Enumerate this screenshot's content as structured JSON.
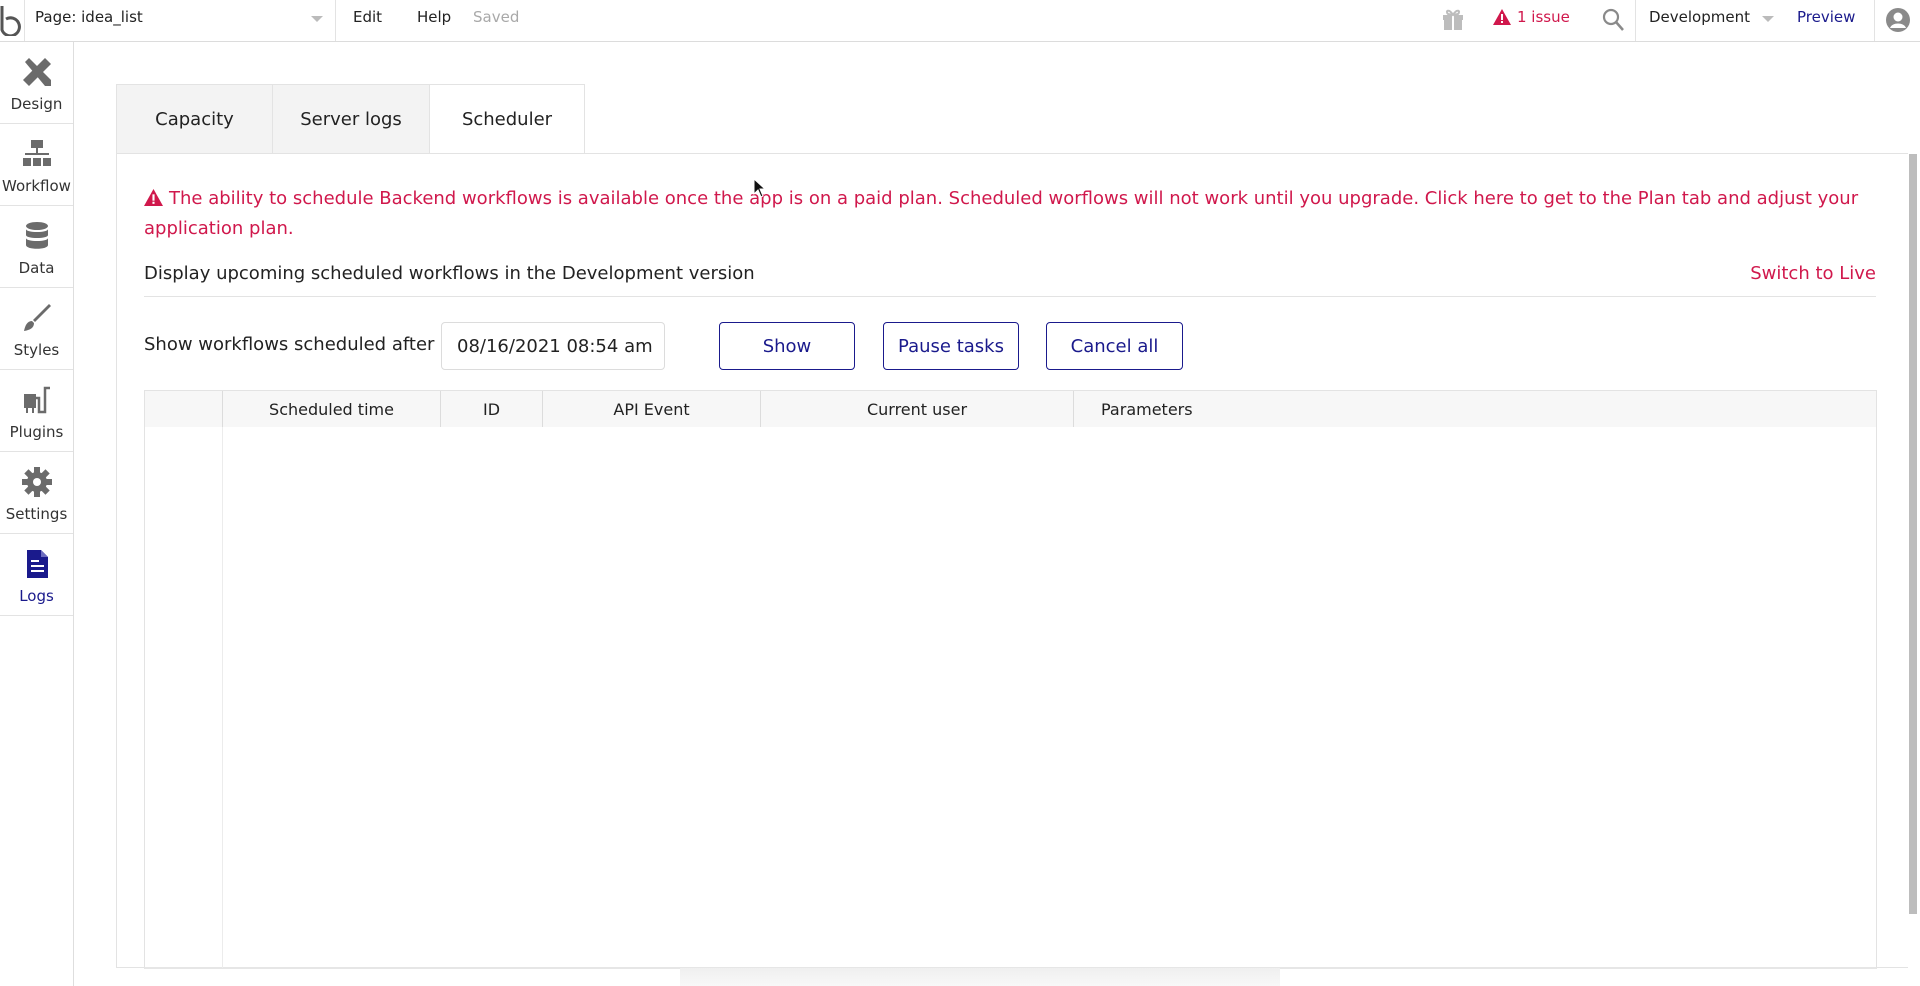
{
  "topbar": {
    "logo_icon": "bubble-logo-icon",
    "page_selector": {
      "label": "Page: idea_list",
      "icon": "chevron-down-icon"
    },
    "menu": [
      {
        "label": "Edit"
      },
      {
        "label": "Help"
      }
    ],
    "save_status": "Saved",
    "gift_icon": "gift-icon",
    "issues": {
      "icon": "warning-icon",
      "label": "1 issue",
      "color": "#d0184c"
    },
    "search_icon": "search-icon",
    "environment": {
      "label": "Development",
      "icon": "chevron-down-icon"
    },
    "preview_label": "Preview",
    "user_icon": "user-avatar-icon"
  },
  "sidebar": {
    "items": [
      {
        "label": "Design",
        "icon": "design-tools-icon",
        "active": false
      },
      {
        "label": "Workflow",
        "icon": "workflow-hierarchy-icon",
        "active": false
      },
      {
        "label": "Data",
        "icon": "database-icon",
        "active": false
      },
      {
        "label": "Styles",
        "icon": "paintbrush-icon",
        "active": false
      },
      {
        "label": "Plugins",
        "icon": "plug-icon",
        "active": false
      },
      {
        "label": "Settings",
        "icon": "gear-icon",
        "active": false
      },
      {
        "label": "Logs",
        "icon": "document-icon",
        "active": true
      }
    ]
  },
  "main": {
    "tabs": [
      {
        "label": "Capacity",
        "active": false
      },
      {
        "label": "Server logs",
        "active": false
      },
      {
        "label": "Scheduler",
        "active": true
      }
    ],
    "warning": {
      "icon": "warning-icon",
      "text": "The ability to schedule Backend workflows is available once the app is on a paid plan. Scheduled worflows will not work until you upgrade. Click here to get to the Plan tab and adjust your application plan."
    },
    "display_text": "Display upcoming scheduled workflows in the Development version",
    "switch_link": "Switch to Live",
    "filter": {
      "label": "Show workflows scheduled after",
      "date_value": "08/16/2021 08:54 am",
      "buttons": {
        "show": "Show",
        "pause": "Pause tasks",
        "cancel_all": "Cancel all"
      }
    },
    "table": {
      "columns": [
        "",
        "Scheduled time",
        "ID",
        "API Event",
        "Current user",
        "Parameters"
      ],
      "rows": []
    }
  },
  "colors": {
    "accent": "#1a1a8c",
    "alert": "#d0184c"
  }
}
